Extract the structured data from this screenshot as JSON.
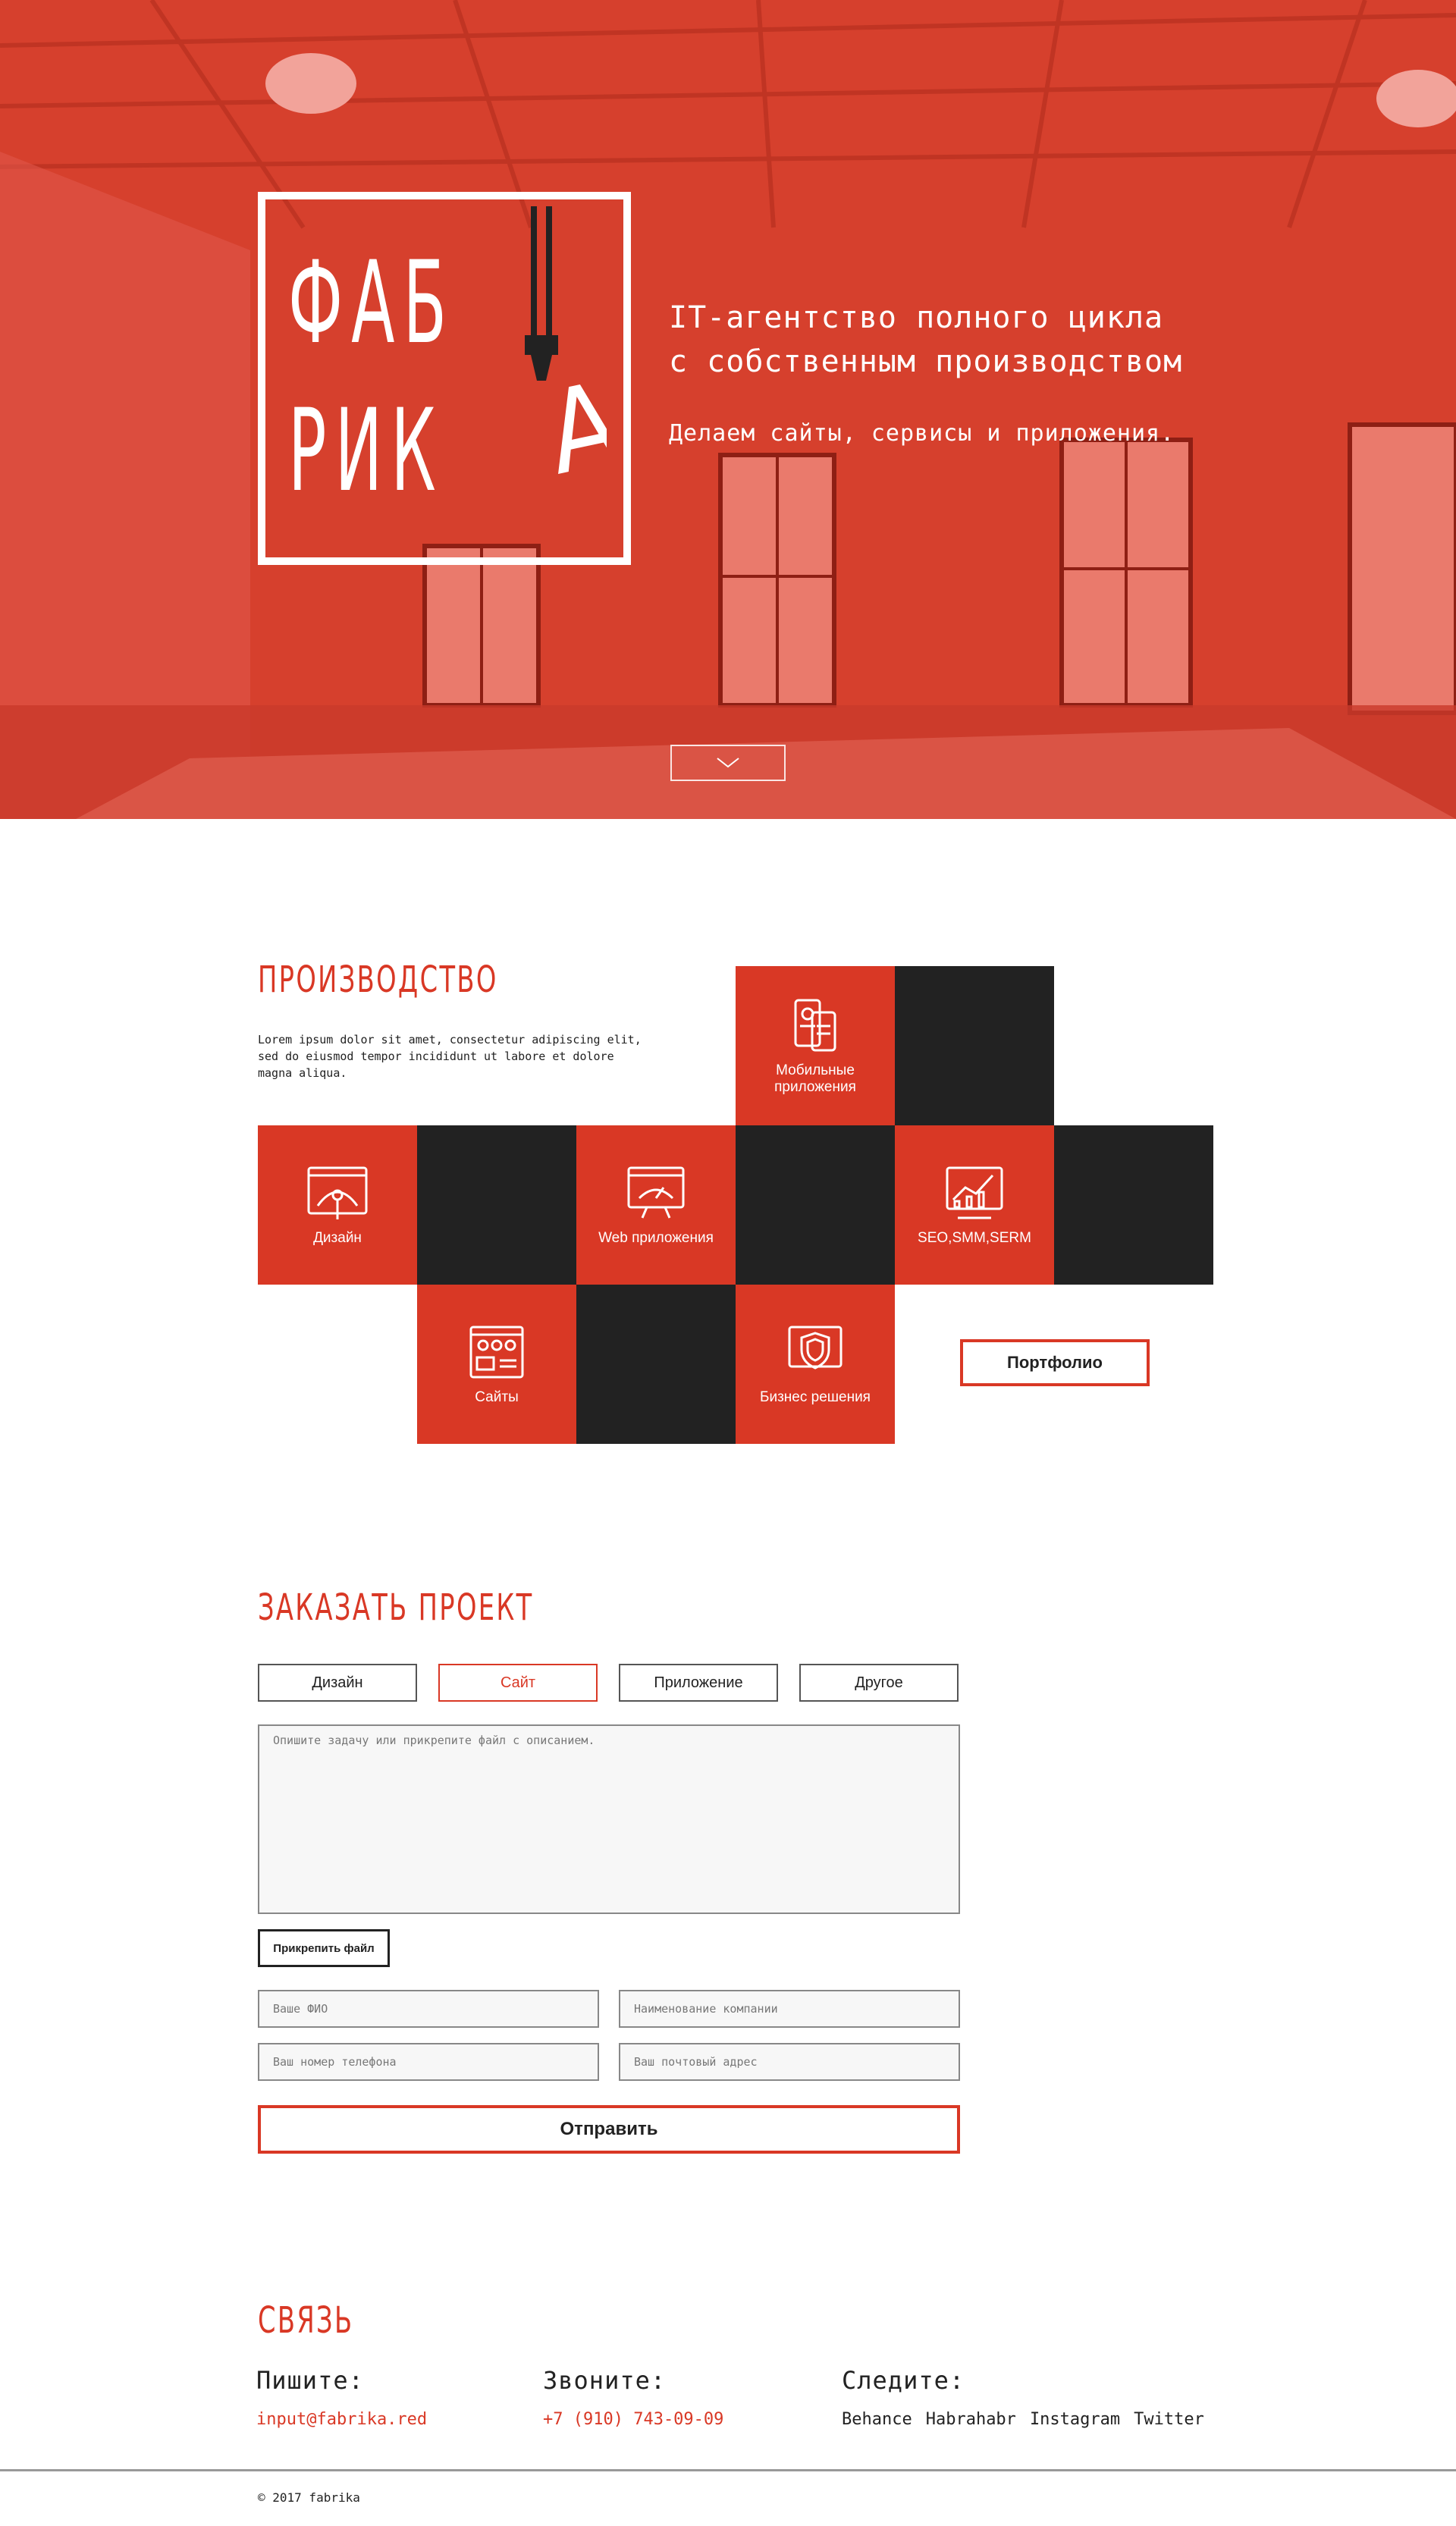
{
  "hero": {
    "logo_line1": "ФАБ",
    "logo_line2": "РИК",
    "logo_letter": "А",
    "tagline_line1": "IT-агентство полного цикла",
    "tagline_line2": "с собственным производством",
    "subtagline": "Делаем сайты, сервисы и приложения.",
    "accent_color": "#d93825"
  },
  "production": {
    "title": "ПРОИЗВОДСТВО",
    "description": "Lorem ipsum dolor sit amet, consectetur adipiscing elit, sed do eiusmod tempor incididunt ut labore et dolore magna aliqua.",
    "tiles": [
      {
        "label": "Мобильные приложения",
        "icon": "mobile-apps-icon"
      },
      {
        "label": "Дизайн",
        "icon": "design-icon"
      },
      {
        "label": "Web приложения",
        "icon": "web-apps-icon"
      },
      {
        "label": "SEO,SMM,SERM",
        "icon": "analytics-icon"
      },
      {
        "label": "Сайты",
        "icon": "websites-icon"
      },
      {
        "label": "Бизнес решения",
        "icon": "shield-icon"
      }
    ],
    "portfolio_label": "Портфолио"
  },
  "order": {
    "title": "ЗАКАЗАТЬ ПРОЕКТ",
    "options": [
      "Дизайн",
      "Сайт",
      "Приложение",
      "Другое"
    ],
    "selected_option": "Сайт",
    "description_placeholder": "Опишите задачу или прикрепите файл с описанием.",
    "attach_label": "Прикрепить файл",
    "name_placeholder": "Ваше ФИО",
    "company_placeholder": "Наименование компании",
    "phone_placeholder": "Ваш номер телефона",
    "email_placeholder": "Ваш почтовый адрес",
    "submit_label": "Отправить"
  },
  "contacts": {
    "title": "СВЯЗЬ",
    "write_label": "Пишите:",
    "email": "input@fabrika.red",
    "call_label": "Звоните:",
    "phone": "+7 (910) 743-09-09",
    "follow_label": "Следите:",
    "social": [
      "Behance",
      "Habrahabr",
      "Instagram",
      "Twitter"
    ]
  },
  "footer": {
    "copyright": "© 2017 fabrika"
  }
}
